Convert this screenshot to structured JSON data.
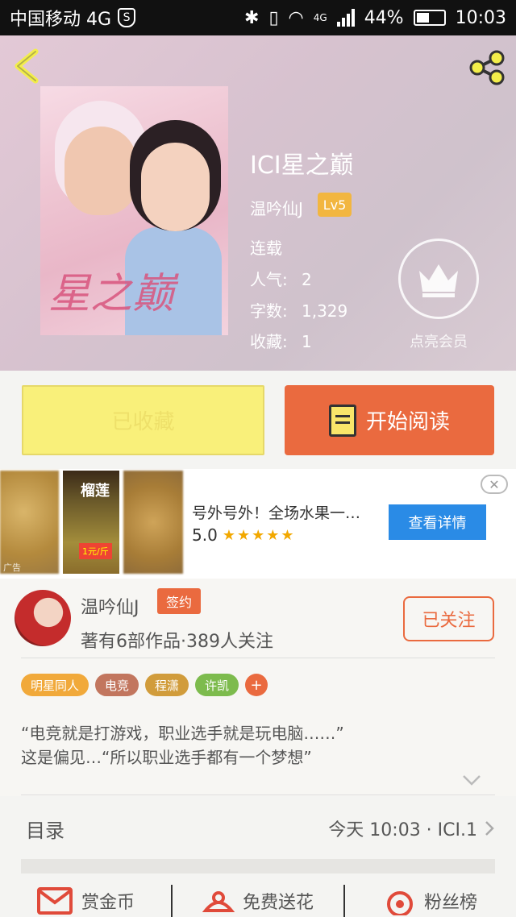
{
  "status_bar": {
    "carrier": "中国移动 4G",
    "shield": "S",
    "network": "4G",
    "battery": "44%",
    "time": "10:03"
  },
  "header": {
    "back_icon": "chevron-left-icon",
    "share_icon": "share-icon"
  },
  "book": {
    "cover_text": "星之巅",
    "title": "ICI星之巅",
    "author": "温吟仙J",
    "level": "Lv5",
    "status": "连载",
    "meta": [
      {
        "key": "人气:",
        "value": "2"
      },
      {
        "key": "字数:",
        "value": "1,329"
      },
      {
        "key": "收藏:",
        "value": "1"
      }
    ],
    "vip_label": "点亮会员"
  },
  "actions": {
    "collected_label": "已收藏",
    "read_label": "开始阅读"
  },
  "ad": {
    "text": "号外号外！全场水果一…",
    "rating": "5.0",
    "stars": "★★★★★",
    "button": "查看详情",
    "close": "✕",
    "img_label": "榴莲",
    "price": "1元/斤",
    "ad_tag": "广告"
  },
  "author_card": {
    "name": "温吟仙J",
    "sign_badge": "签约",
    "stats": "著有6部作品·389人关注",
    "follow_label": "已关注",
    "tags": [
      {
        "label": "明星同人",
        "color": "#f1a93a"
      },
      {
        "label": "电竞",
        "color": "#c2765e"
      },
      {
        "label": "程潇",
        "color": "#d19c3b"
      },
      {
        "label": "许凯",
        "color": "#7dbb4d"
      }
    ],
    "tag_add": "+"
  },
  "description": {
    "line1": "“电竞就是打游戏，职业选手就是玩电脑……”",
    "line2": "这是偏见…“所以职业选手都有一个梦想”"
  },
  "catalog": {
    "label": "目录",
    "update": "今天 10:03 · ICI.1"
  },
  "bottom_bar": {
    "items": [
      {
        "label": "赏金币",
        "icon": "envelope-icon"
      },
      {
        "label": "免费送花",
        "icon": "flower-icon"
      },
      {
        "label": "粉丝榜",
        "icon": "target-icon"
      }
    ]
  },
  "colors": {
    "accent": "#ea6a3f",
    "collect_bg": "#f9f07a",
    "ad_button": "#2a8be6"
  }
}
